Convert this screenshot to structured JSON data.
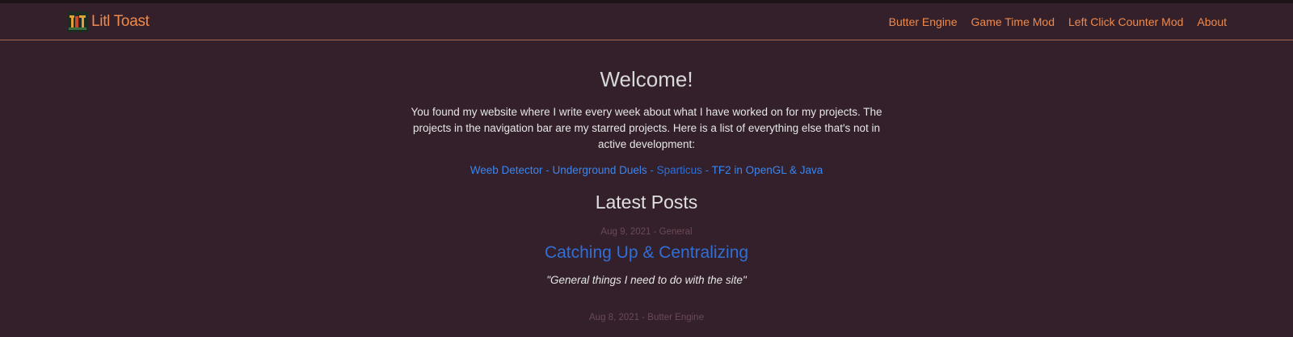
{
  "brand": {
    "name": "Litl Toast"
  },
  "nav": {
    "links": [
      "Butter Engine",
      "Game Time Mod",
      "Left Click Counter Mod",
      "About"
    ]
  },
  "hero": {
    "title": "Welcome!",
    "intro": "You found my website where I write every week about what I have worked on for my projects. The projects in the navigation bar are my starred projects. Here is a list of everything else that's not in active development:"
  },
  "projects": {
    "items": [
      "Weeb Detector",
      "Underground Duels",
      "Sparticus",
      "TF2 in OpenGL & Java"
    ],
    "separator": " - "
  },
  "latest": {
    "heading": "Latest Posts",
    "posts": [
      {
        "date": "Aug 9, 2021",
        "category": "General",
        "title": "Catching Up & Centralizing",
        "summary": "\"General things I need to do with the site\""
      },
      {
        "date": "Aug 8, 2021",
        "category": "Butter Engine"
      }
    ],
    "meta_separator": " - "
  },
  "colors": {
    "background": "#33202b",
    "accent": "#f08a4b",
    "link": "#3a86f0",
    "meta": "#6b4a56"
  }
}
